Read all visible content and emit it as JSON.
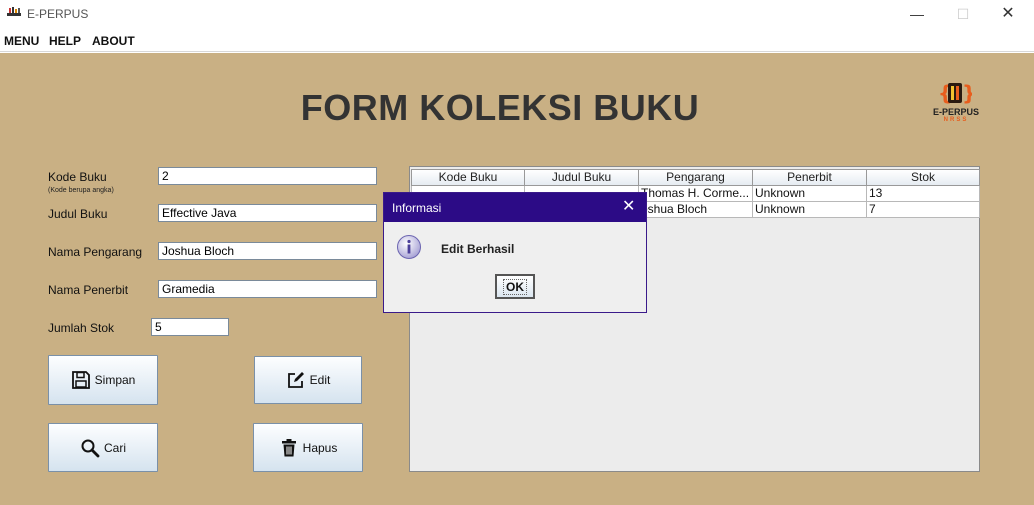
{
  "window": {
    "title": "E-PERPUS",
    "minimize_glyph": "—",
    "maximize_glyph": "☐",
    "close_glyph": "✕"
  },
  "menubar": {
    "items": [
      {
        "label": "MENU"
      },
      {
        "label": "HELP"
      },
      {
        "label": "ABOUT"
      }
    ]
  },
  "form": {
    "title": "FORM KOLEKSI BUKU",
    "logo_text": "E-PERPUS",
    "logo_sub": "NRSS",
    "kode_buku_label": "Kode Buku",
    "kode_buku_hint": "(Kode berupa angka)",
    "kode_buku_value": "2",
    "judul_buku_label": "Judul Buku",
    "judul_buku_value": "Effective Java",
    "nama_pengarang_label": "Nama Pengarang",
    "nama_pengarang_value": "Joshua Bloch",
    "nama_penerbit_label": "Nama Penerbit",
    "nama_penerbit_value": "Gramedia",
    "jumlah_stok_label": "Jumlah Stok",
    "jumlah_stok_value": "5"
  },
  "buttons": {
    "simpan": "Simpan",
    "edit": "Edit",
    "cari": "Cari",
    "hapus": "Hapus"
  },
  "table": {
    "headers": [
      "Kode Buku",
      "Judul Buku",
      "Pengarang",
      "Penerbit",
      "Stok"
    ],
    "rows": [
      [
        "",
        "",
        "Thomas H. Corme...",
        "Unknown",
        "13"
      ],
      [
        "",
        "",
        "oshua Bloch",
        "Unknown",
        "7"
      ]
    ]
  },
  "dialog": {
    "title": "Informasi",
    "close_glyph": "✕",
    "message": "Edit Berhasil",
    "ok_label": "OK"
  },
  "colors": {
    "background": "#c9b084",
    "dialog_title_bar": "#2c0b86",
    "title_text": "#333333",
    "logo_accent": "#e85d1d"
  },
  "icons": {
    "app": "app-icon",
    "simpan": "save-icon",
    "edit": "edit-icon",
    "cari": "search-icon",
    "hapus": "trash-icon",
    "dialog": "info-icon"
  }
}
